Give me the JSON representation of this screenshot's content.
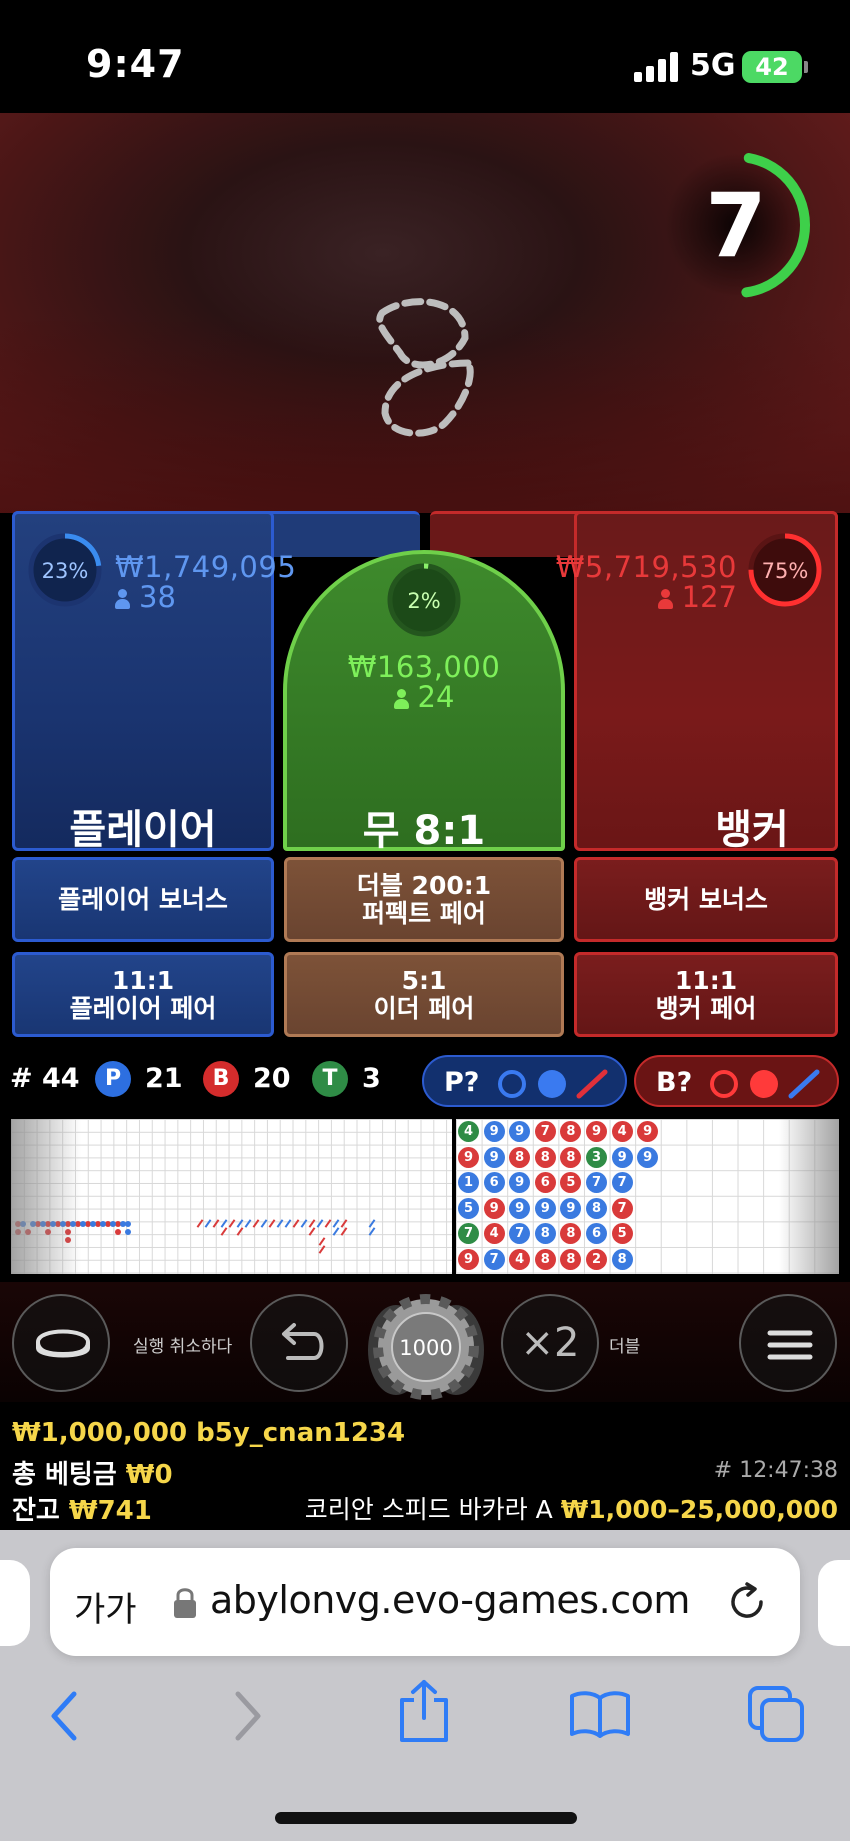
{
  "status_bar": {
    "time": "9:47",
    "network": "5G",
    "battery": "42"
  },
  "timer": {
    "value": "7",
    "progress": 0.45
  },
  "player": {
    "percent": "23%",
    "percent_value": 0.23,
    "amount": "₩1,749,095",
    "bettors": "38",
    "label": "플레이어"
  },
  "tie": {
    "percent": "2%",
    "percent_value": 0.02,
    "amount": "₩163,000",
    "bettors": "24",
    "label": "무 8:1"
  },
  "banker": {
    "percent": "75%",
    "percent_value": 0.75,
    "amount": "₩5,719,530",
    "bettors": "127",
    "label": "뱅커"
  },
  "side_bets": {
    "player_bonus": "플레이어 보너스",
    "perfect_pair_line1": "더블 200:1",
    "perfect_pair_line2": "퍼펙트 페어",
    "banker_bonus": "뱅커 보너스",
    "player_pair_line1": "11:1",
    "player_pair_line2": "플레이어 페어",
    "either_pair_line1": "5:1",
    "either_pair_line2": "이더 페어",
    "banker_pair_line1": "11:1",
    "banker_pair_line2": "뱅커 페어"
  },
  "stats": {
    "round": "# 44",
    "p_letter": "P",
    "p_count": "21",
    "b_letter": "B",
    "b_count": "20",
    "t_letter": "T",
    "t_count": "3",
    "player_predict": "P?",
    "banker_predict": "B?"
  },
  "bead_road": [
    [
      {
        "n": "4",
        "c": "g"
      },
      {
        "n": "9",
        "c": "r"
      },
      {
        "n": "1",
        "c": "b"
      },
      {
        "n": "5",
        "c": "b"
      },
      {
        "n": "7",
        "c": "g"
      },
      {
        "n": "9",
        "c": "r"
      }
    ],
    [
      {
        "n": "9",
        "c": "b"
      },
      {
        "n": "9",
        "c": "b"
      },
      {
        "n": "6",
        "c": "b"
      },
      {
        "n": "9",
        "c": "r"
      },
      {
        "n": "4",
        "c": "r"
      },
      {
        "n": "7",
        "c": "b"
      }
    ],
    [
      {
        "n": "9",
        "c": "b"
      },
      {
        "n": "8",
        "c": "r"
      },
      {
        "n": "9",
        "c": "b"
      },
      {
        "n": "9",
        "c": "b"
      },
      {
        "n": "7",
        "c": "b"
      },
      {
        "n": "4",
        "c": "r"
      }
    ],
    [
      {
        "n": "7",
        "c": "r"
      },
      {
        "n": "8",
        "c": "r"
      },
      {
        "n": "6",
        "c": "r"
      },
      {
        "n": "9",
        "c": "b"
      },
      {
        "n": "8",
        "c": "b"
      },
      {
        "n": "8",
        "c": "r"
      }
    ],
    [
      {
        "n": "8",
        "c": "r"
      },
      {
        "n": "8",
        "c": "r"
      },
      {
        "n": "5",
        "c": "r"
      },
      {
        "n": "9",
        "c": "b"
      },
      {
        "n": "8",
        "c": "r"
      },
      {
        "n": "8",
        "c": "r"
      }
    ],
    [
      {
        "n": "9",
        "c": "r"
      },
      {
        "n": "3",
        "c": "g"
      },
      {
        "n": "7",
        "c": "b"
      },
      {
        "n": "8",
        "c": "b"
      },
      {
        "n": "6",
        "c": "b"
      },
      {
        "n": "2",
        "c": "r"
      }
    ],
    [
      {
        "n": "4",
        "c": "r"
      },
      {
        "n": "9",
        "c": "b"
      },
      {
        "n": "7",
        "c": "b"
      },
      {
        "n": "7",
        "c": "r"
      },
      {
        "n": "5",
        "c": "r"
      },
      {
        "n": "8",
        "c": "b"
      }
    ],
    [
      {
        "n": "9",
        "c": "r"
      },
      {
        "n": "9",
        "c": "b"
      }
    ]
  ],
  "controls": {
    "undo_label": "실행 취소하다",
    "chip_value": "1000",
    "double_symbol": "×2",
    "double_label": "더블"
  },
  "info": {
    "balance_user": "₩1,000,000 b5y_cnan1234",
    "total_bet_label": "총 베팅금",
    "total_bet_value": "₩0",
    "game_time": "# 12:47:38",
    "balance_label": "잔고",
    "balance_value": "₩741",
    "game_name": "코리안 스피드 바카라 A",
    "limits": "₩1,000–25,000,000"
  },
  "browser": {
    "text_size": "가가",
    "url": "abylonvg.evo-games.com"
  },
  "colors": {
    "player_blue": "#2c5bd0",
    "banker_red": "#c42a2a",
    "tie_green": "#6fd04a",
    "timer_green": "#3ed04a",
    "gold": "#f6d64a"
  }
}
